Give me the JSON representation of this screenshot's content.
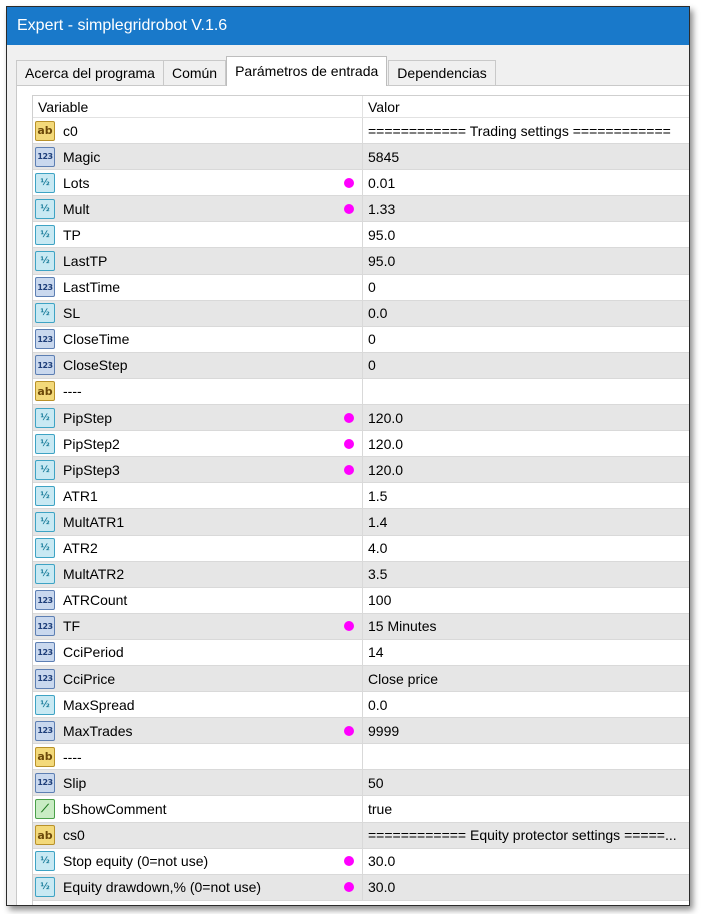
{
  "window": {
    "title": "Expert - simplegridrobot V.1.6"
  },
  "tabs": [
    {
      "label": "Acerca del programa",
      "active": false
    },
    {
      "label": "Común",
      "active": false
    },
    {
      "label": "Parámetros de entrada",
      "active": true
    },
    {
      "label": "Dependencias",
      "active": false
    }
  ],
  "table": {
    "columns": {
      "variable": "Variable",
      "value": "Valor"
    },
    "icon_glyphs": {
      "string": "ab",
      "integer": "123",
      "double": "½",
      "bool": "⟋"
    },
    "colors": {
      "modified_dot": "#ff00ff",
      "title_bar": "#1979ca"
    },
    "rows": [
      {
        "name": "c0",
        "type": "string",
        "value": "============ Trading settings ============",
        "modified": false
      },
      {
        "name": "Magic",
        "type": "integer",
        "value": "5845",
        "modified": false
      },
      {
        "name": "Lots",
        "type": "double",
        "value": "0.01",
        "modified": true
      },
      {
        "name": "Mult",
        "type": "double",
        "value": "1.33",
        "modified": true
      },
      {
        "name": "TP",
        "type": "double",
        "value": "95.0",
        "modified": false
      },
      {
        "name": "LastTP",
        "type": "double",
        "value": "95.0",
        "modified": false
      },
      {
        "name": "LastTime",
        "type": "integer",
        "value": "0",
        "modified": false
      },
      {
        "name": "SL",
        "type": "double",
        "value": "0.0",
        "modified": false
      },
      {
        "name": "CloseTime",
        "type": "integer",
        "value": "0",
        "modified": false
      },
      {
        "name": "CloseStep",
        "type": "integer",
        "value": "0",
        "modified": false
      },
      {
        "name": "----",
        "type": "string",
        "value": "",
        "modified": false
      },
      {
        "name": "PipStep",
        "type": "double",
        "value": "120.0",
        "modified": true
      },
      {
        "name": "PipStep2",
        "type": "double",
        "value": "120.0",
        "modified": true
      },
      {
        "name": "PipStep3",
        "type": "double",
        "value": "120.0",
        "modified": true
      },
      {
        "name": "ATR1",
        "type": "double",
        "value": "1.5",
        "modified": false
      },
      {
        "name": "MultATR1",
        "type": "double",
        "value": "1.4",
        "modified": false
      },
      {
        "name": "ATR2",
        "type": "double",
        "value": "4.0",
        "modified": false
      },
      {
        "name": "MultATR2",
        "type": "double",
        "value": "3.5",
        "modified": false
      },
      {
        "name": "ATRCount",
        "type": "integer",
        "value": "100",
        "modified": false
      },
      {
        "name": "TF",
        "type": "integer",
        "value": "15 Minutes",
        "modified": true
      },
      {
        "name": "CciPeriod",
        "type": "integer",
        "value": "14",
        "modified": false
      },
      {
        "name": "CciPrice",
        "type": "integer",
        "value": "Close price",
        "modified": false
      },
      {
        "name": "MaxSpread",
        "type": "double",
        "value": "0.0",
        "modified": false
      },
      {
        "name": "MaxTrades",
        "type": "integer",
        "value": "9999",
        "modified": true
      },
      {
        "name": "----",
        "type": "string",
        "value": "",
        "modified": false
      },
      {
        "name": "Slip",
        "type": "integer",
        "value": "50",
        "modified": false
      },
      {
        "name": "bShowComment",
        "type": "bool",
        "value": "true",
        "modified": false
      },
      {
        "name": "cs0",
        "type": "string",
        "value": "============ Equity protector settings =====...",
        "modified": false
      },
      {
        "name": "Stop equity (0=not use)",
        "type": "double",
        "value": "30.0",
        "modified": true
      },
      {
        "name": "Equity drawdown,% (0=not use)",
        "type": "double",
        "value": "30.0",
        "modified": true
      }
    ]
  }
}
